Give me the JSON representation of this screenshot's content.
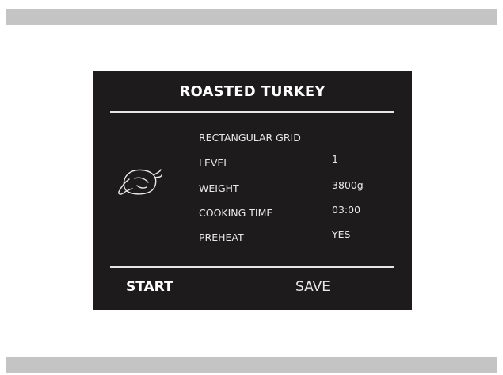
{
  "recipe": {
    "title": "ROASTED TURKEY",
    "icon": "roast-turkey-icon"
  },
  "settings": [
    {
      "label": "RECTANGULAR GRID",
      "value": ""
    },
    {
      "label": "LEVEL",
      "value": "1"
    },
    {
      "label": "WEIGHT",
      "value": "3800g"
    },
    {
      "label": "COOKING TIME",
      "value": "03:00"
    },
    {
      "label": "PREHEAT",
      "value": "YES"
    }
  ],
  "actions": {
    "start_label": "START",
    "save_label": "SAVE"
  },
  "colors": {
    "screen_background": "#1d1b1c",
    "text": "#ffffff",
    "bars": "#c4c4c4"
  }
}
